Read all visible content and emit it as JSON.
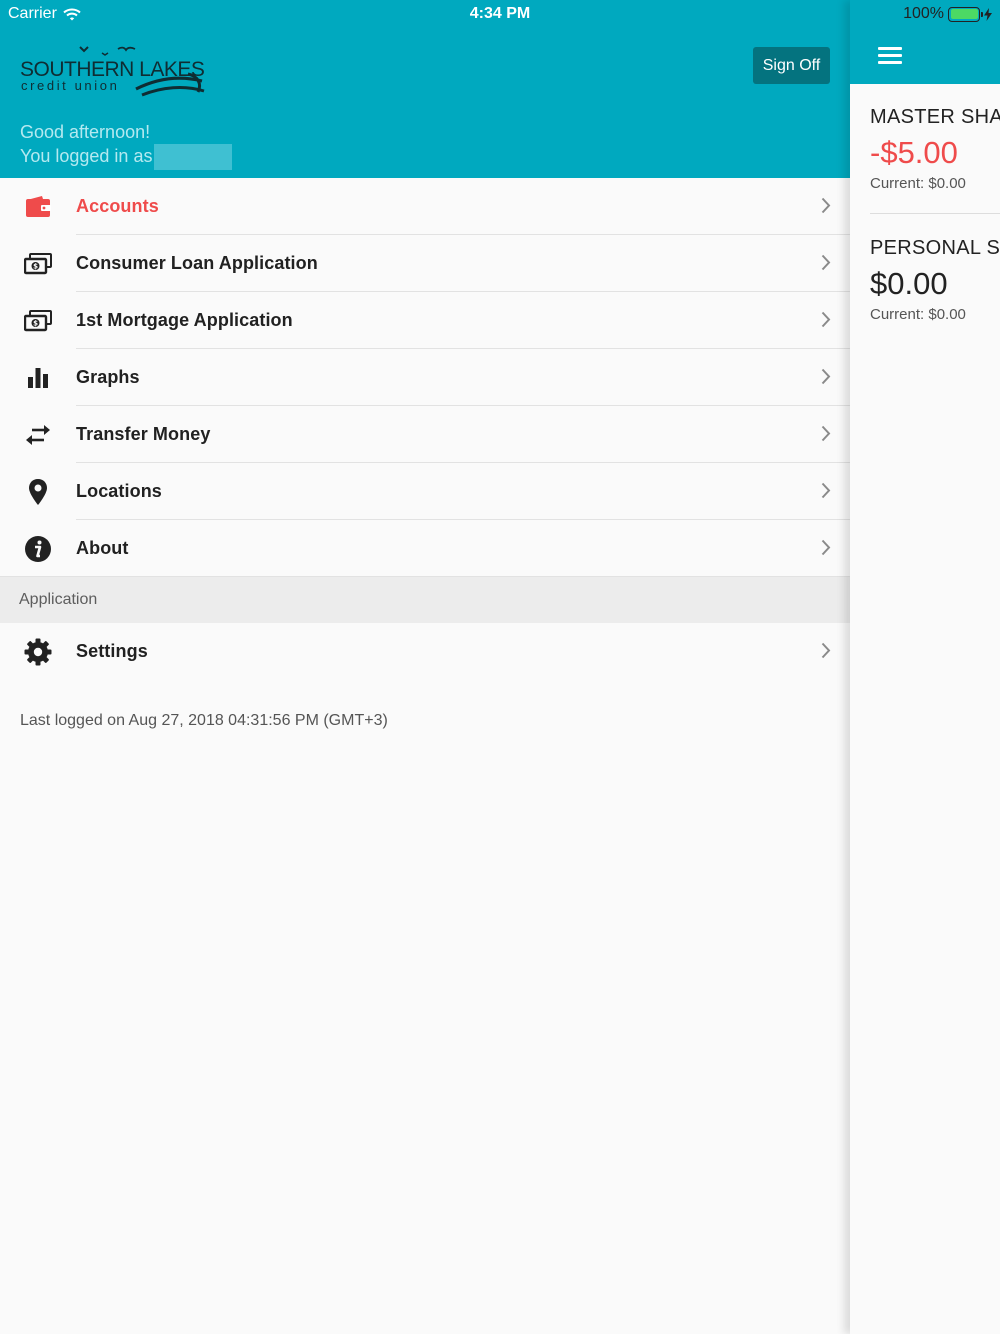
{
  "status_bar": {
    "carrier": "Carrier",
    "time": "4:34 PM",
    "battery_percent": "100%",
    "battery_level": 1.0
  },
  "header": {
    "logo_name": "SOUTHERN LAKES",
    "logo_sub": "credit union",
    "sign_off_label": "Sign Off",
    "greeting": "Good afternoon!",
    "logged_in_as": "You logged in as"
  },
  "menu": {
    "items": [
      {
        "label": "Accounts",
        "icon": "wallet-icon",
        "active": true
      },
      {
        "label": "Consumer Loan Application",
        "icon": "money-icon"
      },
      {
        "label": "1st Mortgage Application",
        "icon": "money-icon"
      },
      {
        "label": "Graphs",
        "icon": "bar-chart-icon"
      },
      {
        "label": "Transfer Money",
        "icon": "transfer-icon"
      },
      {
        "label": "Locations",
        "icon": "location-pin-icon"
      },
      {
        "label": "About",
        "icon": "info-icon"
      }
    ],
    "section_title": "Application",
    "settings_label": "Settings"
  },
  "last_logged": "Last logged on Aug 27, 2018 04:31:56 PM (GMT+3)",
  "accounts": [
    {
      "name": "MASTER SHAI",
      "balance": "-$5.00",
      "current": "Current: $0.00"
    },
    {
      "name": "PERSONAL SH",
      "balance": "$0.00",
      "current": "Current: $0.00"
    }
  ],
  "colors": {
    "brand_teal": "#00a9bf",
    "sign_off_bg": "#04737f",
    "active_red": "#ef4b4b",
    "battery_green": "#4cd964"
  }
}
